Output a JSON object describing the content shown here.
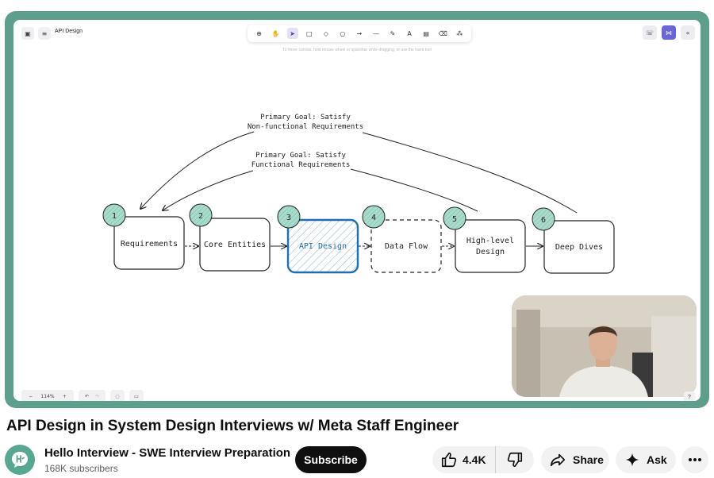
{
  "board": {
    "title": "API Design",
    "hint": "To move canvas, hold mouse wheel or spacebar while dragging, or use the hand tool",
    "zoom": "114%"
  },
  "diagram": {
    "goal_nonfunctional_line1": "Primary Goal: Satisfy",
    "goal_nonfunctional_line2": "Non-functional Requirements",
    "goal_functional_line1": "Primary Goal: Satisfy",
    "goal_functional_line2": "Functional Requirements",
    "steps": [
      {
        "num": "1",
        "line1": "Requirements",
        "line2": ""
      },
      {
        "num": "2",
        "line1": "Core Entities",
        "line2": ""
      },
      {
        "num": "3",
        "line1": "API Design",
        "line2": ""
      },
      {
        "num": "4",
        "line1": "Data Flow",
        "line2": ""
      },
      {
        "num": "5",
        "line1": "High-level",
        "line2": "Design"
      },
      {
        "num": "6",
        "line1": "Deep Dives",
        "line2": ""
      }
    ],
    "accent_color": "#1c6fb3",
    "badge_color": "#a8dccc"
  },
  "video": {
    "title": "API Design in System Design Interviews w/ Meta Staff Engineer"
  },
  "channel": {
    "name": "Hello Interview - SWE Interview Preparation",
    "subscribers": "168K subscribers",
    "subscribe_label": "Subscribe"
  },
  "actions": {
    "likes": "4.4K",
    "share_label": "Share",
    "ask_label": "Ask"
  }
}
